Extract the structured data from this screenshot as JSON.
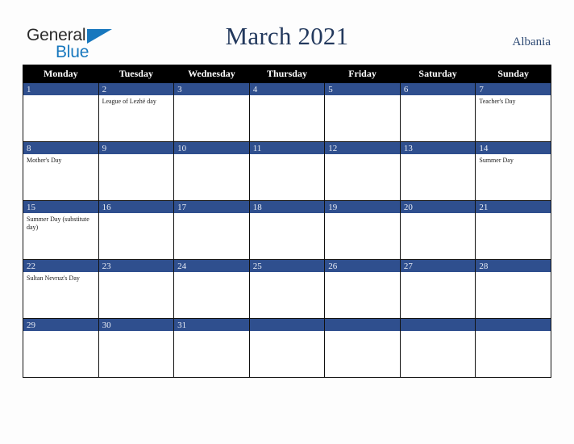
{
  "brand": {
    "name": "general-blue-logo",
    "line1": "General",
    "line2": "Blue",
    "triangle_icon": "blue-triangle-icon",
    "colors": {
      "text": "#2b2b2b",
      "accent": "#1878be"
    }
  },
  "header": {
    "title": "March 2021",
    "region": "Albania",
    "title_color": "#23395d"
  },
  "calendar": {
    "weekday_headers": [
      "Monday",
      "Tuesday",
      "Wednesday",
      "Thursday",
      "Friday",
      "Saturday",
      "Sunday"
    ],
    "colors": {
      "header_bg": "#000000",
      "header_text": "#ffffff",
      "daynum_bg": "#2f4f8e",
      "daynum_text": "#e8ecf5",
      "cell_bg": "#ffffff",
      "grid_line": "#111111"
    },
    "weeks": [
      [
        {
          "day": "1",
          "events": []
        },
        {
          "day": "2",
          "events": [
            "League of Lezhë day"
          ]
        },
        {
          "day": "3",
          "events": []
        },
        {
          "day": "4",
          "events": []
        },
        {
          "day": "5",
          "events": []
        },
        {
          "day": "6",
          "events": []
        },
        {
          "day": "7",
          "events": [
            "Teacher's Day"
          ]
        }
      ],
      [
        {
          "day": "8",
          "events": [
            "Mother's Day"
          ]
        },
        {
          "day": "9",
          "events": []
        },
        {
          "day": "10",
          "events": []
        },
        {
          "day": "11",
          "events": []
        },
        {
          "day": "12",
          "events": []
        },
        {
          "day": "13",
          "events": []
        },
        {
          "day": "14",
          "events": [
            "Summer Day"
          ]
        }
      ],
      [
        {
          "day": "15",
          "events": [
            "Summer Day (substitute day)"
          ]
        },
        {
          "day": "16",
          "events": []
        },
        {
          "day": "17",
          "events": []
        },
        {
          "day": "18",
          "events": []
        },
        {
          "day": "19",
          "events": []
        },
        {
          "day": "20",
          "events": []
        },
        {
          "day": "21",
          "events": []
        }
      ],
      [
        {
          "day": "22",
          "events": [
            "Sultan Nevruz's Day"
          ]
        },
        {
          "day": "23",
          "events": []
        },
        {
          "day": "24",
          "events": []
        },
        {
          "day": "25",
          "events": []
        },
        {
          "day": "26",
          "events": []
        },
        {
          "day": "27",
          "events": []
        },
        {
          "day": "28",
          "events": []
        }
      ],
      [
        {
          "day": "29",
          "events": []
        },
        {
          "day": "30",
          "events": []
        },
        {
          "day": "31",
          "events": []
        },
        {
          "day": "",
          "events": []
        },
        {
          "day": "",
          "events": []
        },
        {
          "day": "",
          "events": []
        },
        {
          "day": "",
          "events": []
        }
      ]
    ]
  }
}
